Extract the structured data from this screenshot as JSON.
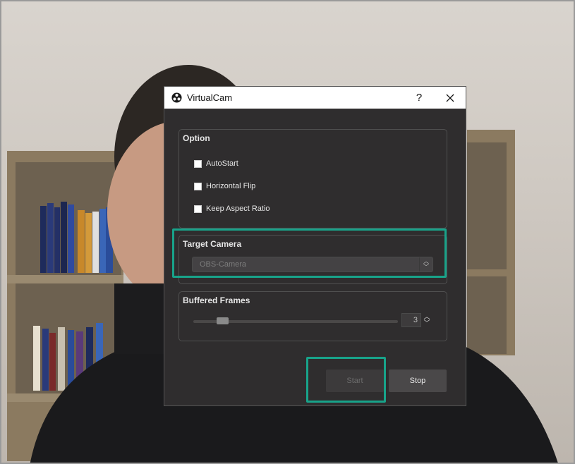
{
  "window": {
    "title": "VirtualCam",
    "help_label": "?",
    "close_label": "✕"
  },
  "option": {
    "title": "Option",
    "checkboxes": [
      {
        "label": "AutoStart",
        "checked": false
      },
      {
        "label": "Horizontal Flip",
        "checked": false
      },
      {
        "label": "Keep Aspect Ratio",
        "checked": false
      }
    ]
  },
  "target_camera": {
    "title": "Target Camera",
    "selected": "OBS-Camera"
  },
  "buffered_frames": {
    "title": "Buffered Frames",
    "value": "3",
    "slider_fraction": 0.12
  },
  "buttons": {
    "start": "Start",
    "stop": "Stop"
  },
  "colors": {
    "dialog_bg": "#2f2d2e",
    "highlight": "#18a38a"
  },
  "icons": {
    "app": "obs-logo-icon"
  }
}
